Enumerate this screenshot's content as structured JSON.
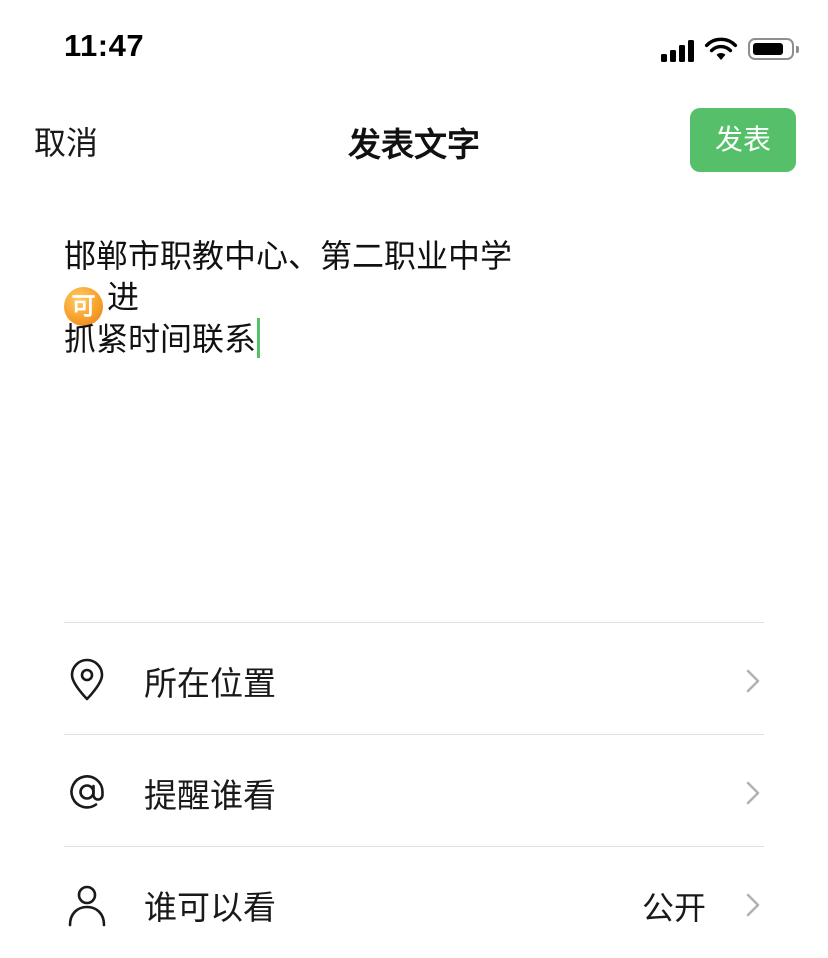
{
  "status_bar": {
    "time": "11:47",
    "icons": [
      "signal-icon",
      "wifi-icon",
      "battery-icon"
    ]
  },
  "nav": {
    "cancel_label": "取消",
    "title": "发表文字",
    "publish_label": "发表",
    "publish_color": "#55c069"
  },
  "composer": {
    "line1": "邯郸市职教中心、第二职业中学",
    "emoji_text": "可",
    "line2_text": "进",
    "line3": "抓紧时间联系",
    "cursor_color": "#55c069"
  },
  "options": [
    {
      "icon": "location-pin-icon",
      "label": "所在位置",
      "value": ""
    },
    {
      "icon": "at-sign-icon",
      "label": "提醒谁看",
      "value": ""
    },
    {
      "icon": "person-icon",
      "label": "谁可以看",
      "value": "公开"
    }
  ]
}
